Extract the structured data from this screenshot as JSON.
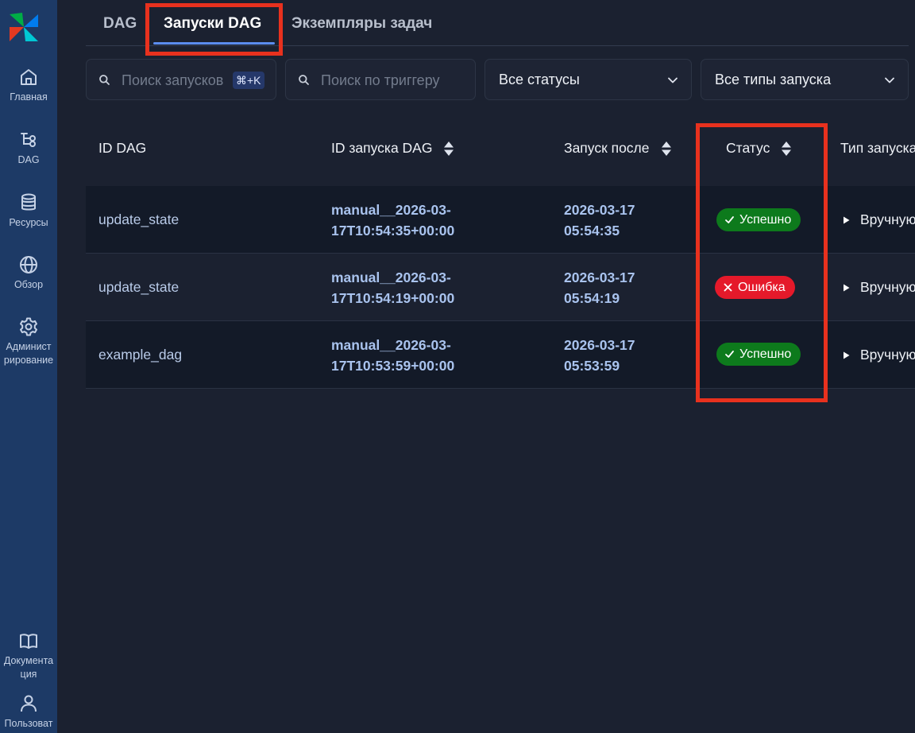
{
  "sidebar": {
    "items": [
      {
        "label_lines": [
          "Главная"
        ],
        "icon": "home-icon"
      },
      {
        "label_lines": [
          "DAG"
        ],
        "icon": "dag-icon"
      },
      {
        "label_lines": [
          "Ресурсы"
        ],
        "icon": "database-icon"
      },
      {
        "label_lines": [
          "Обзор"
        ],
        "icon": "globe-icon"
      },
      {
        "label_lines": [
          "Админист",
          "рирование"
        ],
        "icon": "gear-icon"
      }
    ],
    "bottom_items": [
      {
        "label_lines": [
          "Документа",
          "ция"
        ],
        "icon": "book-icon"
      },
      {
        "label_lines": [
          "Пользоват"
        ],
        "icon": "user-icon"
      }
    ]
  },
  "tabs": [
    {
      "label": "DAG",
      "active": false
    },
    {
      "label": "Запуски DAG",
      "active": true
    },
    {
      "label": "Экземпляры задач",
      "active": false
    }
  ],
  "filters": {
    "search_runs_placeholder": "Поиск запусков",
    "search_runs_shortcut": "⌘+K",
    "search_trigger_placeholder": "Поиск по триггеру",
    "status_select": "Все статусы",
    "run_type_select": "Все типы запуска"
  },
  "table": {
    "headers": [
      "ID DAG",
      "ID запуска DAG",
      "Запуск после",
      "Статус",
      "Тип запуска"
    ],
    "rows": [
      {
        "dag_id": "update_state",
        "run_id_line1": "manual__2026-03-",
        "run_id_line2": "17T10:54:35+00:00",
        "run_after_line1": "2026-03-17",
        "run_after_line2": "05:54:35",
        "status": "Успешно",
        "status_kind": "success",
        "run_type": "Вручную"
      },
      {
        "dag_id": "update_state",
        "run_id_line1": "manual__2026-03-",
        "run_id_line2": "17T10:54:19+00:00",
        "run_after_line1": "2026-03-17",
        "run_after_line2": "05:54:19",
        "status": "Ошибка",
        "status_kind": "failed",
        "run_type": "Вручную"
      },
      {
        "dag_id": "example_dag",
        "run_id_line1": "manual__2026-03-",
        "run_id_line2": "17T10:53:59+00:00",
        "run_after_line1": "2026-03-17",
        "run_after_line2": "05:53:59",
        "status": "Успешно",
        "status_kind": "success",
        "run_type": "Вручную"
      }
    ]
  },
  "colors": {
    "background": "#1b2130",
    "sidebar": "#1d3a66",
    "accent": "#5b8def",
    "success": "#0d7a1c",
    "failed": "#e5192a",
    "highlight": "#e8311e"
  }
}
